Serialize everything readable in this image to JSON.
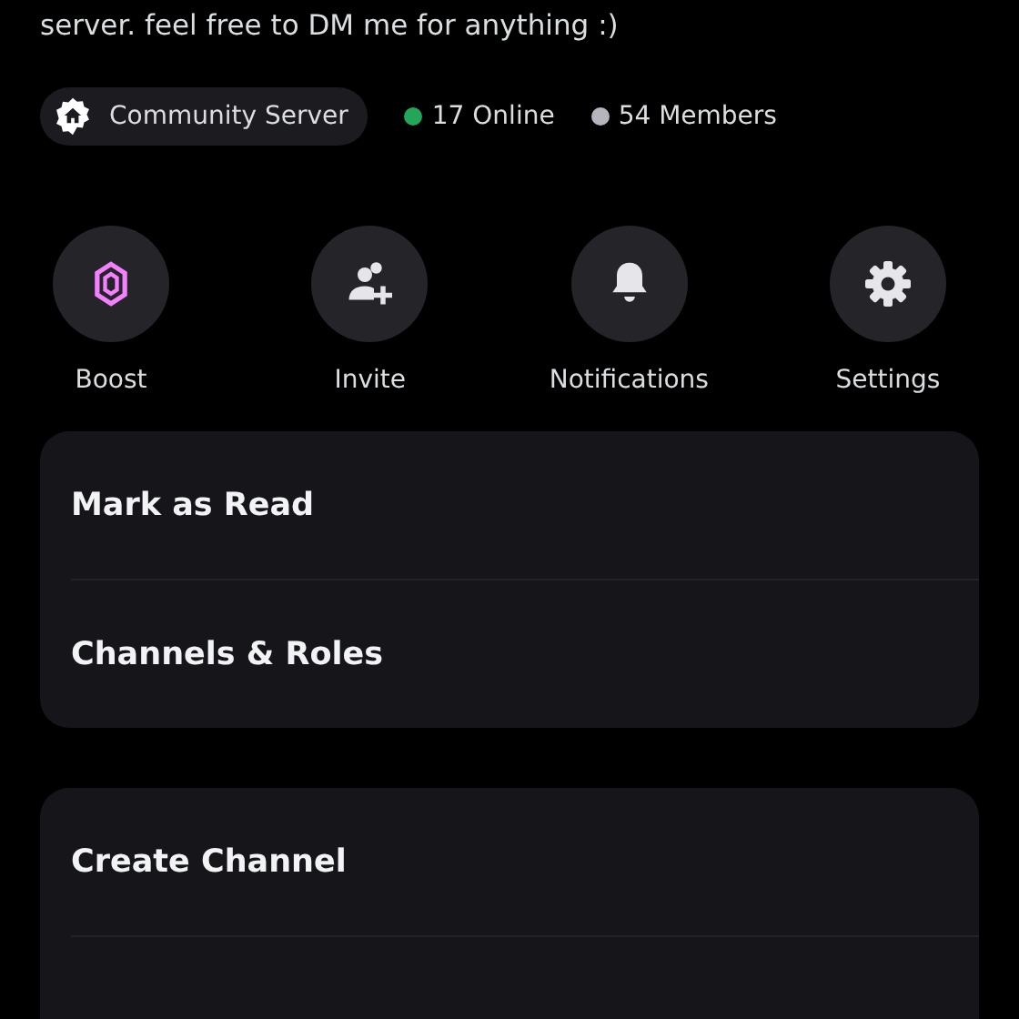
{
  "description": "server. feel free to DM me for anything :)",
  "tags": [
    {
      "kind": "pill",
      "label": "Community Server"
    },
    {
      "kind": "dot",
      "label": "17 Online",
      "color": "#23a55a"
    },
    {
      "kind": "dot",
      "label": "54 Members",
      "color": "#b5b5bd"
    }
  ],
  "actions": [
    {
      "kind": "boost",
      "label": "Boost"
    },
    {
      "kind": "invite",
      "label": "Invite"
    },
    {
      "kind": "bell",
      "label": "Notifications"
    },
    {
      "kind": "gear",
      "label": "Settings"
    }
  ],
  "menu_groups": [
    {
      "items": [
        "Mark as Read",
        "Channels & Roles"
      ]
    },
    {
      "items": [
        "Create Channel"
      ]
    }
  ]
}
